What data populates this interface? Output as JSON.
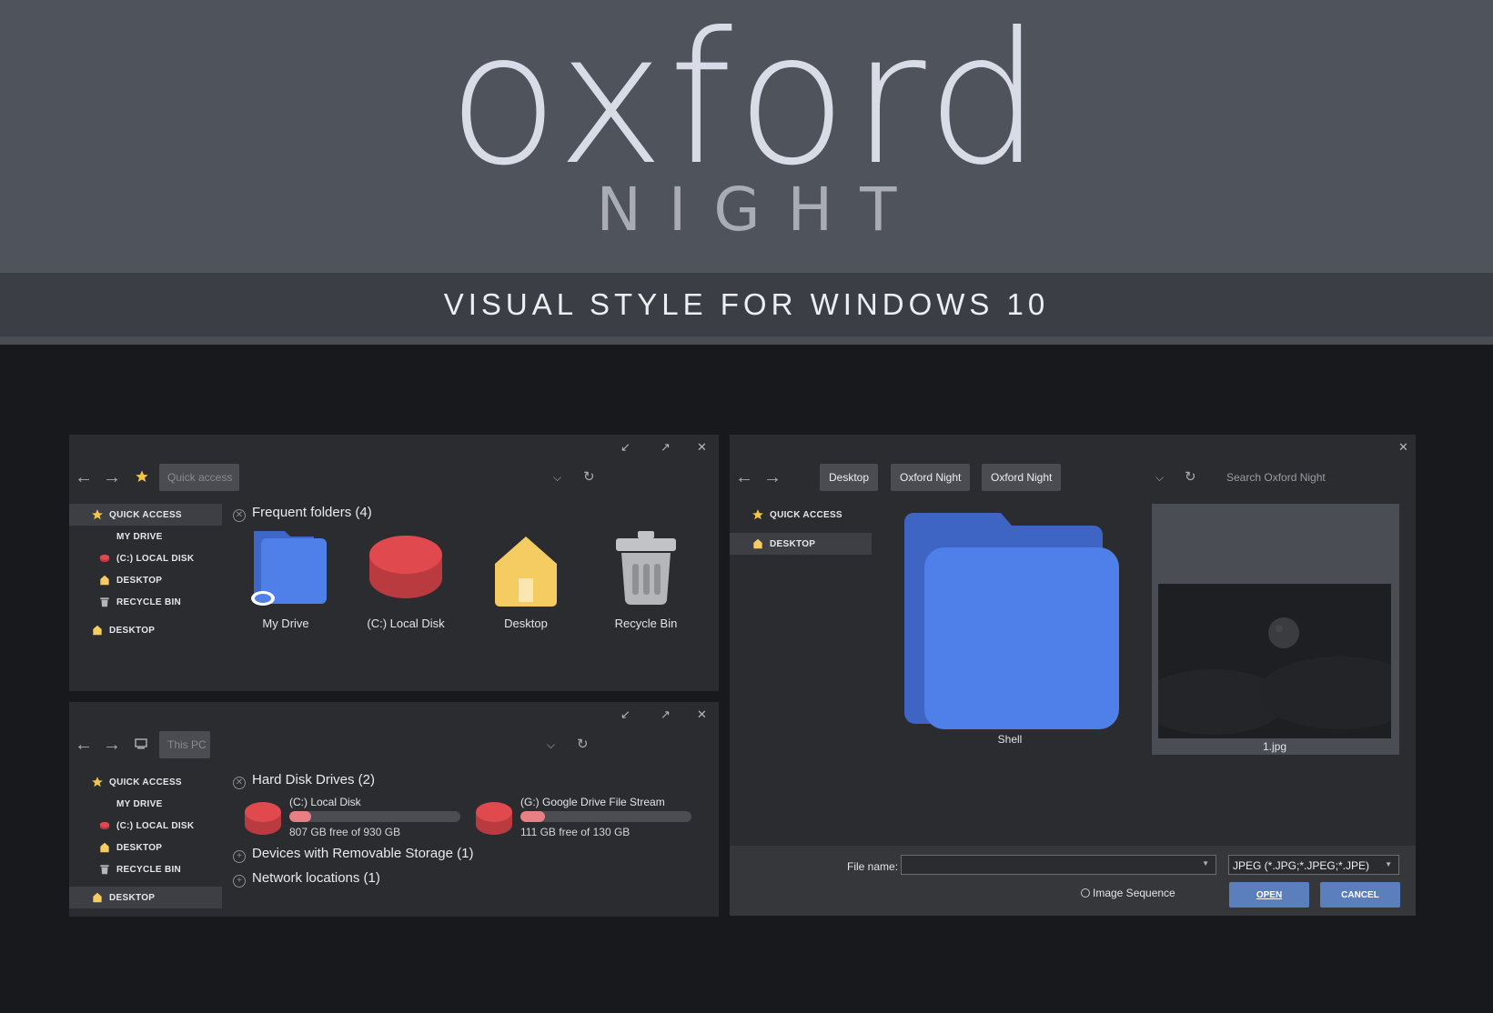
{
  "banner": {
    "title": "oxford",
    "subtitle": "NIGHT",
    "tagline": "VISUAL STYLE FOR WINDOWS 10"
  },
  "colors": {
    "accent": "#5b7fbd",
    "folder_blue": "#4f7fe8",
    "disk_red": "#e04a4f",
    "home_yellow": "#f5cc62",
    "progress": "#e87f82"
  },
  "window_controls": {
    "minimize": "↙",
    "maximize": "↗",
    "close": "✕"
  },
  "explorer_quick": {
    "nav": {
      "back": "←",
      "forward": "→"
    },
    "address": "Quick access",
    "sidebar": [
      {
        "label": "QUICK ACCESS",
        "icon": "star-icon"
      },
      {
        "label": "MY DRIVE",
        "icon": ""
      },
      {
        "label": "(C:) LOCAL DISK",
        "icon": "disk-icon"
      },
      {
        "label": "DESKTOP",
        "icon": "home-icon"
      },
      {
        "label": "RECYCLE BIN",
        "icon": "trash-icon"
      },
      {
        "label": "DESKTOP",
        "icon": "home-icon"
      }
    ],
    "section_title": "Frequent folders (4)",
    "tiles": [
      {
        "label": "My Drive",
        "icon": "cloud-folder-icon"
      },
      {
        "label": "(C:) Local Disk",
        "icon": "disk-icon"
      },
      {
        "label": "Desktop",
        "icon": "home-icon"
      },
      {
        "label": "Recycle Bin",
        "icon": "trash-icon"
      }
    ]
  },
  "explorer_pc": {
    "nav": {
      "back": "←",
      "forward": "→"
    },
    "address": "This PC",
    "sidebar": [
      {
        "label": "QUICK ACCESS",
        "icon": "star-icon"
      },
      {
        "label": "MY DRIVE",
        "icon": ""
      },
      {
        "label": "(C:) LOCAL DISK",
        "icon": "disk-icon"
      },
      {
        "label": "DESKTOP",
        "icon": "home-icon"
      },
      {
        "label": "RECYCLE BIN",
        "icon": "trash-icon"
      },
      {
        "label": "DESKTOP",
        "icon": "home-icon"
      }
    ],
    "sections": [
      {
        "title": "Hard Disk Drives (2)",
        "sign": "✕"
      },
      {
        "title": "Devices with Removable Storage (1)",
        "sign": "+"
      },
      {
        "title": "Network locations (1)",
        "sign": "+"
      }
    ],
    "drives": [
      {
        "name": "(C:) Local Disk",
        "free_text": "807 GB free of 930 GB",
        "used_fraction": 0.13
      },
      {
        "name": "(G:) Google Drive File Stream",
        "free_text": "111 GB free of 130 GB",
        "used_fraction": 0.146
      }
    ]
  },
  "open_dialog": {
    "nav": {
      "back": "←",
      "forward": "→"
    },
    "breadcrumbs": [
      "Desktop",
      "Oxford Night",
      "Oxford Night"
    ],
    "search_placeholder": "Search Oxford Night",
    "sidebar": [
      {
        "label": "QUICK ACCESS",
        "icon": "star-icon"
      },
      {
        "label": "DESKTOP",
        "icon": "home-icon"
      }
    ],
    "items": [
      {
        "label": "Shell",
        "icon": "folder-icon"
      },
      {
        "label": "1.jpg",
        "icon": "image-thumbnail"
      }
    ],
    "file_name_label": "File name:",
    "file_name_value": "",
    "file_type": "JPEG (*.JPG;*.JPEG;*.JPE)",
    "image_sequence_label": "Image Sequence",
    "open_label": "OPEN",
    "cancel_label": "CANCEL"
  }
}
